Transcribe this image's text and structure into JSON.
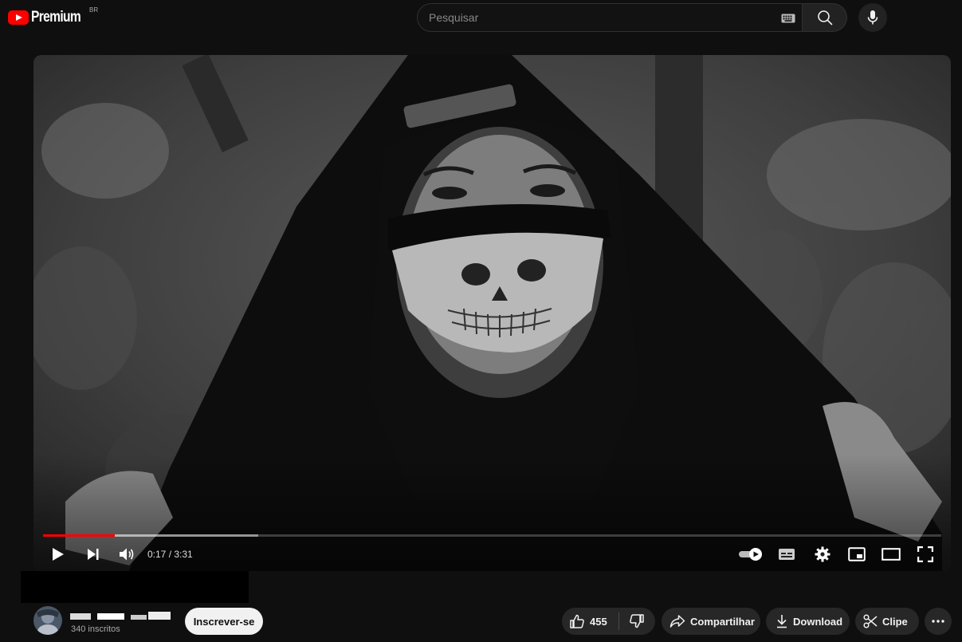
{
  "header": {
    "logo_text": "Premium",
    "country_code": "BR",
    "search_placeholder": "Pesquisar"
  },
  "player": {
    "current_time": "0:17",
    "duration": "3:31",
    "time_separator": " / ",
    "progress_played_fraction": 0.08,
    "progress_buffered_fraction": 0.24,
    "autoplay_on": true
  },
  "channel": {
    "subscribers": "340 inscritos",
    "subscribe_label": "Inscrever-se"
  },
  "actions": {
    "like_count": "455",
    "share_label": "Compartilhar",
    "download_label": "Download",
    "clip_label": "Clipe"
  },
  "colors": {
    "background": "#0f0f0f",
    "accent_red": "#ff0000",
    "pill_bg": "#272727",
    "subscribe_bg": "#f1f1f1"
  },
  "icons": [
    "youtube-logo-icon",
    "keyboard-icon",
    "search-icon",
    "mic-icon",
    "play-icon",
    "next-icon",
    "volume-icon",
    "autoplay-toggle-icon",
    "subtitles-icon",
    "gear-icon",
    "miniplayer-icon",
    "theater-icon",
    "fullscreen-icon",
    "thumbs-up-icon",
    "thumbs-down-icon",
    "share-icon",
    "download-icon",
    "scissors-icon",
    "more-icon"
  ]
}
